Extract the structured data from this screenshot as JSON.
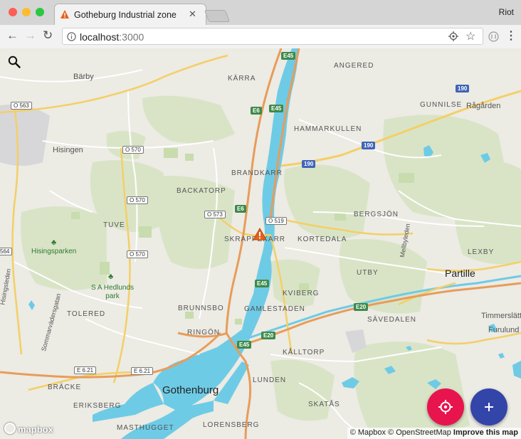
{
  "browser": {
    "tab_title": "Gotheburg Industrial zone",
    "tab_close": "✕",
    "profile_name": "Riot",
    "url_host": "localhost",
    "url_port": ":3000"
  },
  "map": {
    "districts": [
      {
        "id": "karra",
        "text": "KÄRRA"
      },
      {
        "id": "angered",
        "text": "ANGERED"
      },
      {
        "id": "gunnilse",
        "text": "GUNNILSE"
      },
      {
        "id": "hammarkullen",
        "text": "HAMMARKULLEN"
      },
      {
        "id": "brandkarr",
        "text": "BRANDKARR"
      },
      {
        "id": "backatorp",
        "text": "BACKATORP"
      },
      {
        "id": "tuve",
        "text": "TUVE"
      },
      {
        "id": "bergsjon",
        "text": "BERGSJÖN"
      },
      {
        "id": "skarpkarr",
        "text": "SKRAPPEKARR"
      },
      {
        "id": "kortedala",
        "text": "KORTEDALA"
      },
      {
        "id": "utby",
        "text": "UTBY"
      },
      {
        "id": "lexby",
        "text": "LEXBY"
      },
      {
        "id": "kviberg",
        "text": "KVIBERG"
      },
      {
        "id": "tolered",
        "text": "TOLERED"
      },
      {
        "id": "brunnsbo",
        "text": "BRUNNSBO"
      },
      {
        "id": "gamlestaden",
        "text": "GAMLESTADEN"
      },
      {
        "id": "savedalen",
        "text": "SÄVEDALEN"
      },
      {
        "id": "ringon",
        "text": "RINGÖN"
      },
      {
        "id": "kalltorp",
        "text": "KÅLLTORP"
      },
      {
        "id": "bracke",
        "text": "BRÄCKE"
      },
      {
        "id": "lunden",
        "text": "LUNDEN"
      },
      {
        "id": "eriksberg",
        "text": "ERIKSBERG"
      },
      {
        "id": "skatas",
        "text": "SKATÅS"
      },
      {
        "id": "masthugget",
        "text": "MASTHUGGET"
      },
      {
        "id": "lorensberg",
        "text": "LORENSBERG"
      }
    ],
    "places": [
      {
        "id": "barby",
        "text": "Bärby"
      },
      {
        "id": "hisingen",
        "text": "Hisingen"
      },
      {
        "id": "ragarden",
        "text": "Rågården"
      },
      {
        "id": "partille",
        "text": "Partille"
      },
      {
        "id": "timmerslatt",
        "text": "Timmerslätt"
      },
      {
        "id": "furulund",
        "text": "Furulund"
      },
      {
        "id": "gothenburg",
        "text": "Gothenburg"
      }
    ],
    "streets": [
      {
        "id": "hisingsleden",
        "text": "Hisingsleden"
      },
      {
        "id": "sommarvadersgatan",
        "text": "Sommarvädersgatan"
      },
      {
        "id": "mellbyleden",
        "text": "Mellbyleden"
      }
    ],
    "parks": [
      {
        "id": "hisingsparken",
        "text": "Hisingsparken"
      },
      {
        "id": "sahedlunds",
        "line1": "S A Hedlunds",
        "line2": "park"
      }
    ],
    "shields": [
      {
        "id": "e45a",
        "text": "E45"
      },
      {
        "id": "e6a",
        "text": "E6"
      },
      {
        "id": "e45b",
        "text": "E45"
      },
      {
        "id": "e6b",
        "text": "E6"
      },
      {
        "id": "e45c",
        "text": "E45"
      },
      {
        "id": "e45d",
        "text": "E45"
      },
      {
        "id": "e20a",
        "text": "E20"
      },
      {
        "id": "e20b",
        "text": "E20"
      },
      {
        "id": "r190a",
        "text": "190"
      },
      {
        "id": "r190b",
        "text": "190"
      },
      {
        "id": "r190c",
        "text": "190"
      }
    ],
    "route_numbers": [
      {
        "id": "o563",
        "text": "O 563"
      },
      {
        "id": "o570a",
        "text": "O 570"
      },
      {
        "id": "o570b",
        "text": "O 570"
      },
      {
        "id": "o570c",
        "text": "O 570"
      },
      {
        "id": "o573",
        "text": "O 573"
      },
      {
        "id": "o519",
        "text": "O 519"
      },
      {
        "id": "r564",
        "text": "564"
      },
      {
        "id": "e621a",
        "text": "E 6.21"
      },
      {
        "id": "e621b",
        "text": "E 6.21"
      }
    ],
    "mapbox_logo": "mapbox",
    "attribution": "© Mapbox © OpenStreetMap",
    "improve": "Improve this map"
  },
  "colors": {
    "locate_fab": "#e8144e",
    "add_fab": "#3345a8",
    "water": "#6ecbe6",
    "highway": "#e89c5a",
    "warning_marker": "#e8601a"
  }
}
